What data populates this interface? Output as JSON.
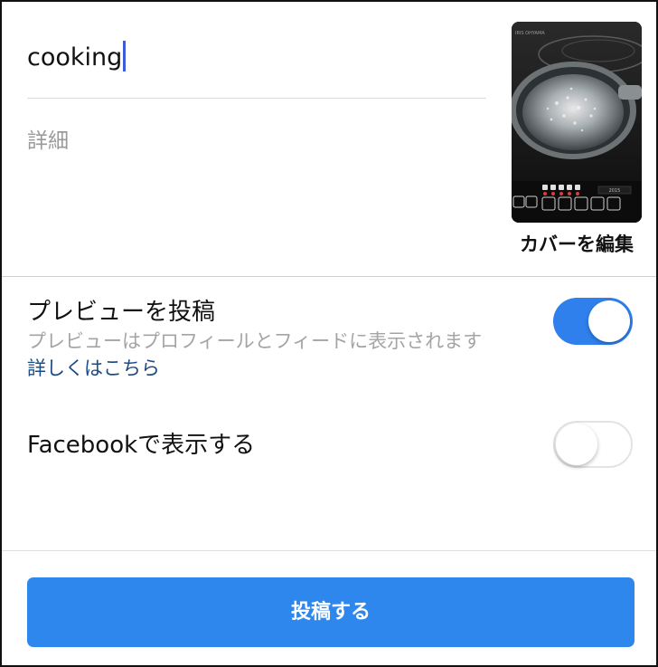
{
  "post": {
    "title_value": "cooking",
    "detail_placeholder": "詳細"
  },
  "cover": {
    "edit_label": "カバーを編集"
  },
  "preview": {
    "title": "プレビューを投稿",
    "subtitle": "プレビューはプロフィールとフィードに表示されます",
    "link": "詳しくはこちら",
    "toggle_on": true
  },
  "facebook": {
    "title": "Facebookで表示する",
    "toggle_on": false
  },
  "actions": {
    "post_label": "投稿する"
  },
  "colors": {
    "accent": "#2e87ec",
    "toggle_on": "#2f80ed",
    "link": "#1c4b86",
    "caret": "#3b5bdb"
  }
}
